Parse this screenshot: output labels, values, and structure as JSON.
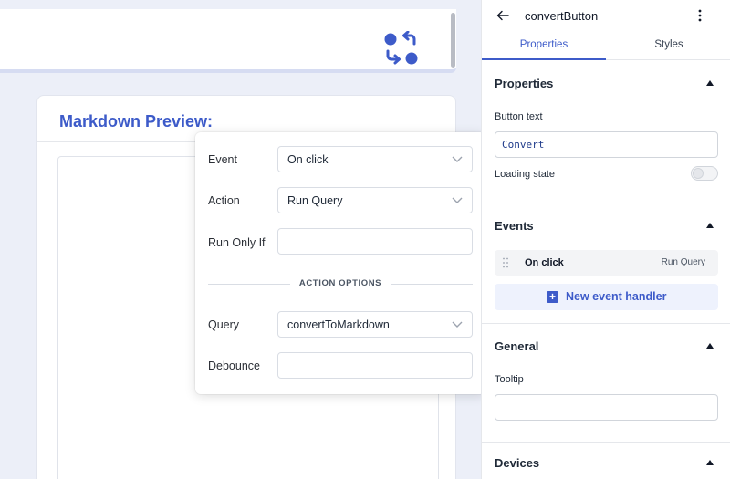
{
  "canvas": {
    "preview_title": "Markdown Preview:"
  },
  "event_popover": {
    "event_label": "Event",
    "event_value": "On click",
    "action_label": "Action",
    "action_value": "Run Query",
    "run_only_if_label": "Run Only If",
    "run_only_if_value": "",
    "section_label": "ACTION OPTIONS",
    "query_label": "Query",
    "query_value": "convertToMarkdown",
    "debounce_label": "Debounce",
    "debounce_value": ""
  },
  "inspector": {
    "component_name": "convertButton",
    "back_icon": "arrow-left-icon",
    "menu_icon": "kebab-menu-icon",
    "tabs": [
      {
        "label": "Properties",
        "active": true
      },
      {
        "label": "Styles",
        "active": false
      }
    ],
    "properties": {
      "heading": "Properties",
      "button_text_label": "Button text",
      "button_text_value": "Convert",
      "loading_state_label": "Loading state",
      "loading_state_on": false
    },
    "events": {
      "heading": "Events",
      "items": [
        {
          "event": "On click",
          "action": "Run Query"
        }
      ],
      "new_handler_label": "New event handler"
    },
    "general": {
      "heading": "General",
      "tooltip_label": "Tooltip",
      "tooltip_value": ""
    },
    "devices": {
      "heading": "Devices"
    }
  },
  "colors": {
    "accent": "#3d5bc9",
    "canvas_bg": "#eceff8"
  }
}
